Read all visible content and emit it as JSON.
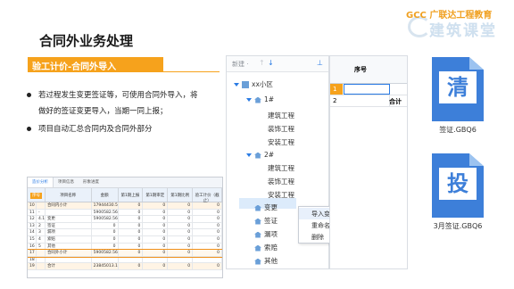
{
  "header": {
    "title": "合同外业务处理"
  },
  "logo": {
    "brand_small": "GCC 广联达工程教育",
    "brand_big": "建筑课堂"
  },
  "section": {
    "label": "验工计价-合同外导入"
  },
  "bullets": [
    "若过程发生变更签证等，可使用合同外导入，将做好的签证变更导入，当期一同上报；",
    "项目自动汇总合同内及合同外部分"
  ],
  "table_screenshot": {
    "tabs": [
      "造价分析",
      "项目信息",
      "形象进度"
    ],
    "headers": {
      "seq": "序号",
      "name": "项目名称",
      "amount": "金额",
      "c1": "第1期上报",
      "c2": "第1期审定",
      "c3": "第1期比例",
      "c4": "验工计价（截止）"
    },
    "rows": [
      {
        "no": "10",
        "seq": "",
        "name": "合同内小计",
        "amount": "17944430.59",
        "c1": "0",
        "c2": "0",
        "c3": "0",
        "c4": "0"
      },
      {
        "no": "11",
        "seq": "-",
        "name": "",
        "amount": "5900582.56",
        "c1": "0",
        "c2": "0",
        "c3": "0",
        "c4": "0"
      },
      {
        "no": "12",
        "seq": "4.1",
        "name": "变更",
        "amount": "5900582.56",
        "c1": "0",
        "c2": "0",
        "c3": "0",
        "c4": "0"
      },
      {
        "no": "13",
        "seq": "2",
        "name": "签证",
        "amount": "0",
        "c1": "0",
        "c2": "0",
        "c3": "0",
        "c4": "0"
      },
      {
        "no": "14",
        "seq": "3",
        "name": "漏项",
        "amount": "0",
        "c1": "0",
        "c2": "0",
        "c3": "0",
        "c4": "0"
      },
      {
        "no": "15",
        "seq": "4",
        "name": "索赔",
        "amount": "0",
        "c1": "0",
        "c2": "0",
        "c3": "0",
        "c4": "0"
      },
      {
        "no": "16",
        "seq": "5",
        "name": "其他",
        "amount": "0",
        "c1": "0",
        "c2": "0",
        "c3": "0",
        "c4": "0"
      },
      {
        "no": "17",
        "seq": "",
        "name": "合同外小计",
        "amount": "5900582.56",
        "c1": "0",
        "c2": "0",
        "c3": "0",
        "c4": "0"
      },
      {
        "no": "18",
        "seq": "",
        "name": "",
        "amount": "",
        "c1": "",
        "c2": "",
        "c3": "",
        "c4": ""
      },
      {
        "no": "19",
        "seq": "",
        "name": "合计",
        "amount": "23845013.15",
        "c1": "0",
        "c2": "0",
        "c3": "0",
        "c4": "0"
      }
    ]
  },
  "panel": {
    "new_label": "新建 ·",
    "tree": [
      {
        "label": "xx小区",
        "level": 0,
        "icon": "building-icon"
      },
      {
        "label": "1#",
        "level": 1,
        "icon": "house-icon"
      },
      {
        "label": "建筑工程",
        "level": 2
      },
      {
        "label": "装饰工程",
        "level": 2
      },
      {
        "label": "安装工程",
        "level": 2
      },
      {
        "label": "2#",
        "level": 1,
        "icon": "house-icon"
      },
      {
        "label": "建筑工程",
        "level": 2
      },
      {
        "label": "装饰工程",
        "level": 2
      },
      {
        "label": "安装工程",
        "level": 2
      },
      {
        "label": "变更",
        "level": 1,
        "icon": "house-icon"
      },
      {
        "label": "签证",
        "level": 1,
        "icon": "house-icon"
      },
      {
        "label": "漏项",
        "level": 1,
        "icon": "house-icon"
      },
      {
        "label": "索赔",
        "level": 1,
        "icon": "house-icon"
      },
      {
        "label": "其他",
        "level": 1,
        "icon": "house-icon"
      }
    ],
    "context_menu": [
      "导入变更",
      "重命名",
      "删除"
    ]
  },
  "grid": {
    "header": "序号",
    "rows": [
      {
        "num": "1",
        "label": ""
      },
      {
        "num": "2",
        "label": "合计"
      }
    ]
  },
  "files": [
    {
      "glyph": "清",
      "name": "签证.GBQ6"
    },
    {
      "glyph": "投",
      "name": "3月签证.GBQ6"
    }
  ]
}
